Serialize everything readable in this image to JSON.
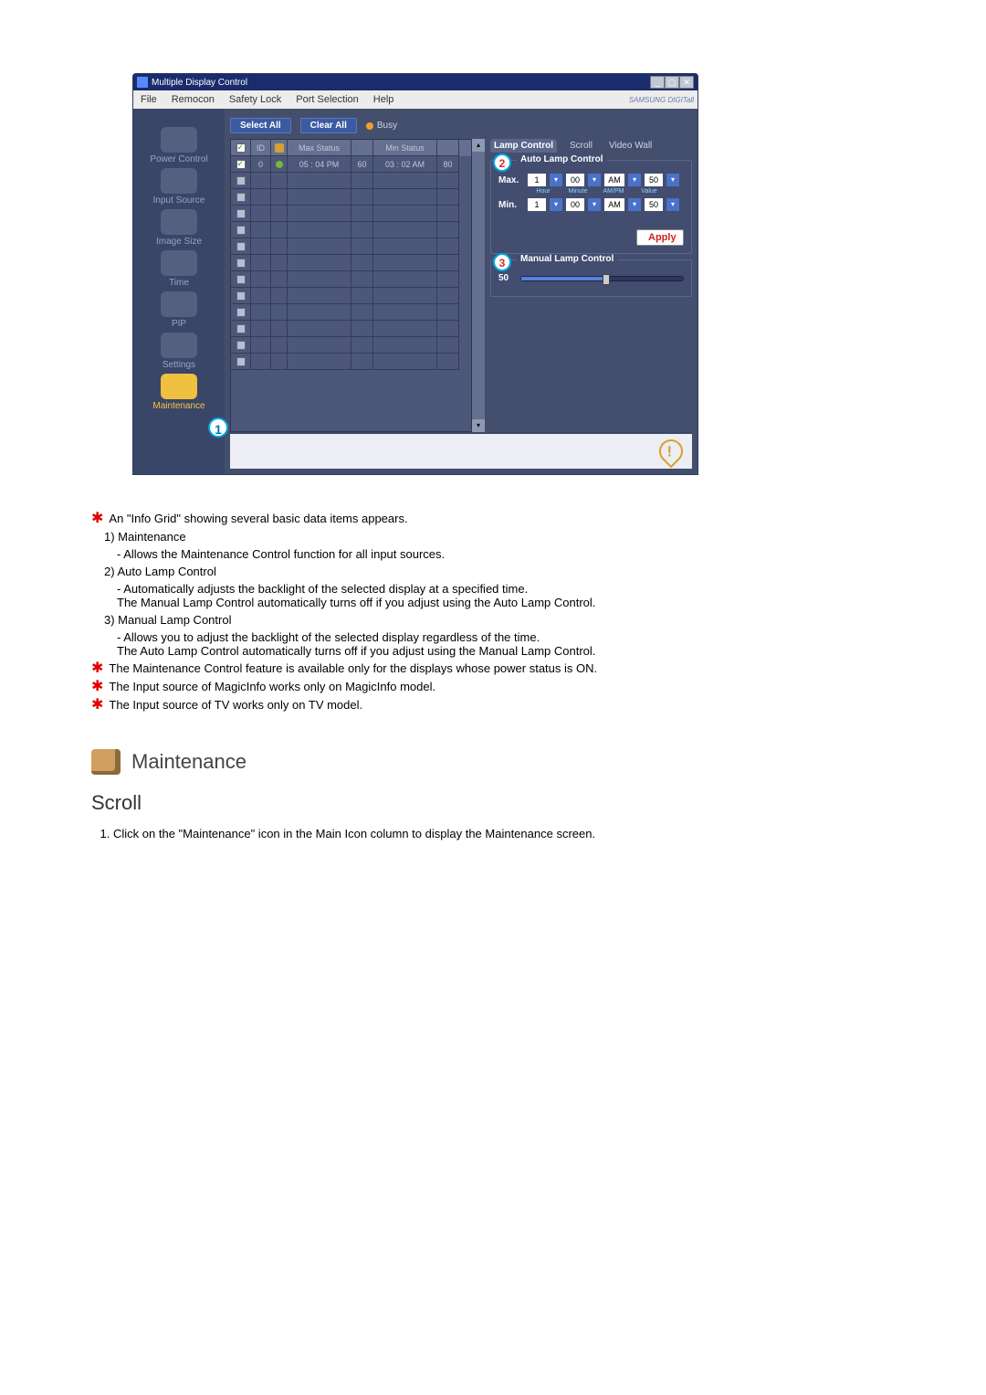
{
  "window": {
    "title": "Multiple Display Control",
    "samsung": "SAMSUNG DIGITall"
  },
  "menu": [
    "File",
    "Remocon",
    "Safety Lock",
    "Port Selection",
    "Help"
  ],
  "sidebar": {
    "items": [
      {
        "label": "Power Control"
      },
      {
        "label": "Input Source"
      },
      {
        "label": "Image Size"
      },
      {
        "label": "Time"
      },
      {
        "label": "PIP"
      },
      {
        "label": "Settings"
      },
      {
        "label": "Maintenance",
        "active": true
      }
    ]
  },
  "toolbar": {
    "select_all": "Select All",
    "clear_all": "Clear All",
    "busy": "Busy"
  },
  "grid": {
    "headers": {
      "c1": "☑",
      "c2": "ID",
      "c3": "●",
      "c4": "Max Status",
      "c5": "",
      "c6": "Min Status",
      "c7": ""
    },
    "rows": [
      {
        "checked": true,
        "id": "0",
        "on": true,
        "max": "05 : 04 PM",
        "maxv": "60",
        "min": "03 : 02 AM",
        "minv": "80"
      }
    ],
    "empty_rows": 10
  },
  "tabs": [
    {
      "label": "Lamp Control",
      "active": true
    },
    {
      "label": "Scroll"
    },
    {
      "label": "Video Wall"
    }
  ],
  "auto_lamp": {
    "title": "Auto Lamp Control",
    "cols": [
      "Hour",
      "Minute",
      "AM/PM",
      "Value"
    ],
    "max": {
      "label": "Max.",
      "hour": "1",
      "minute": "00",
      "ampm": "AM",
      "value": "50"
    },
    "min": {
      "label": "Min.",
      "hour": "1",
      "minute": "00",
      "ampm": "AM",
      "value": "50"
    },
    "apply": "Apply"
  },
  "manual_lamp": {
    "title": "Manual Lamp Control",
    "value": "50"
  },
  "callouts": {
    "c1": "1",
    "c2": "2",
    "c3": "3"
  },
  "doc": {
    "bullet1": "An \"Info Grid\" showing several basic data items appears.",
    "item1_head": "1)  Maintenance",
    "item1_sub": "- Allows the Maintenance Control function for all input sources.",
    "item2_head": "2)  Auto Lamp Control",
    "item2_sub1": "- Automatically adjusts the backlight of the selected display at a specified time.",
    "item2_sub2": "The Manual Lamp Control automatically turns off if you adjust using the Auto Lamp Control.",
    "item3_head": "3)  Manual Lamp Control",
    "item3_sub1": "- Allows you to adjust the backlight of the selected display regardless of the time.",
    "item3_sub2": "The Auto Lamp Control automatically turns off if you adjust using the Manual Lamp Control.",
    "note1": "The Maintenance Control feature is available only for the displays whose power status is ON.",
    "note2": "The Input source of MagicInfo works only on MagicInfo model.",
    "note3": "The Input source of TV works only on TV model.",
    "section_title": "Maintenance",
    "sub_section": "Scroll",
    "step1": "Click on the \"Maintenance\" icon in the Main Icon column to display the Maintenance screen."
  }
}
